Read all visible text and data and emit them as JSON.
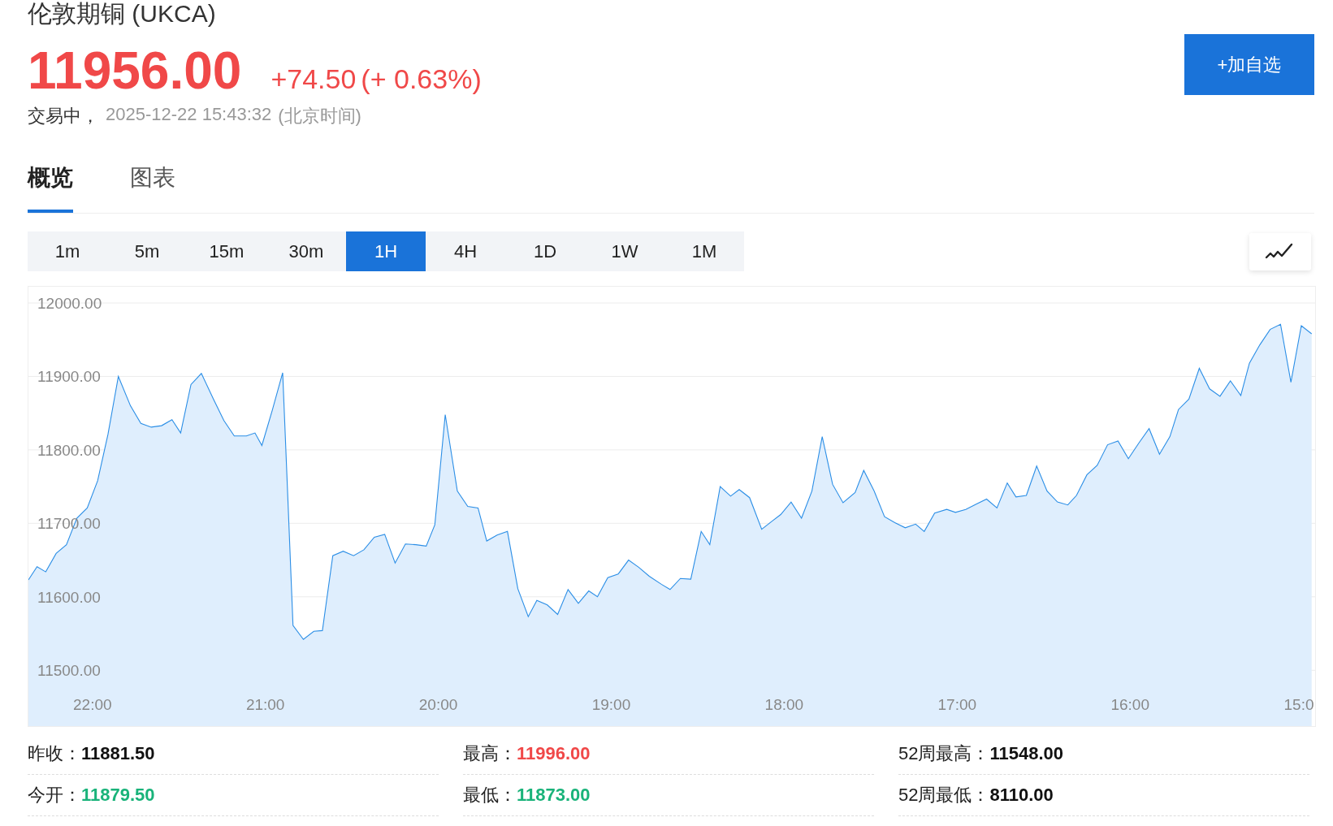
{
  "title": "伦敦期铜 (UKCA)",
  "price": "11956.00",
  "change": "+74.50",
  "change_pct": "(+ 0.63%)",
  "status": "交易中，",
  "timestamp": "2025-12-22 15:43:32",
  "timezone": "(北京时间)",
  "watch_button": "+加自选",
  "tabs": [
    {
      "label": "概览",
      "selected": true
    },
    {
      "label": "图表",
      "selected": false
    }
  ],
  "periods": [
    {
      "label": "1m",
      "selected": false
    },
    {
      "label": "5m",
      "selected": false
    },
    {
      "label": "15m",
      "selected": false
    },
    {
      "label": "30m",
      "selected": false
    },
    {
      "label": "1H",
      "selected": true
    },
    {
      "label": "4H",
      "selected": false
    },
    {
      "label": "1D",
      "selected": false
    },
    {
      "label": "1W",
      "selected": false
    },
    {
      "label": "1M",
      "selected": false
    }
  ],
  "chart_data": {
    "type": "area",
    "grid": true,
    "xlim": [
      22.37,
      14.93
    ],
    "ylim": [
      11424,
      12000
    ],
    "yticks": [
      {
        "value": 12000,
        "label": "12000.00"
      },
      {
        "value": 11900,
        "label": "11900.00"
      },
      {
        "value": 11800,
        "label": "11800.00"
      },
      {
        "value": 11700,
        "label": "11700.00"
      },
      {
        "value": 11600,
        "label": "11600.00"
      },
      {
        "value": 11500,
        "label": "11500.00"
      }
    ],
    "xticks": [
      {
        "value": 22,
        "label": "22:00"
      },
      {
        "value": 21,
        "label": "21:00"
      },
      {
        "value": 20,
        "label": "20:00"
      },
      {
        "value": 19,
        "label": "19:00"
      },
      {
        "value": 18,
        "label": "18:00"
      },
      {
        "value": 17,
        "label": "17:00"
      },
      {
        "value": 16,
        "label": "16:00"
      },
      {
        "value": 15,
        "label": "15:0"
      }
    ],
    "x": [
      22.37,
      22.32,
      22.27,
      22.21,
      22.15,
      22.09,
      22.03,
      21.97,
      21.91,
      21.85,
      21.78,
      21.72,
      21.66,
      21.6,
      21.54,
      21.49,
      21.43,
      21.37,
      21.3,
      21.24,
      21.18,
      21.11,
      21.06,
      21.02,
      20.96,
      20.9,
      20.87,
      20.84,
      20.78,
      20.72,
      20.67,
      20.61,
      20.55,
      20.49,
      20.43,
      20.37,
      20.31,
      20.25,
      20.19,
      20.13,
      20.07,
      20.02,
      19.96,
      19.89,
      19.83,
      19.77,
      19.72,
      19.66,
      19.6,
      19.54,
      19.48,
      19.43,
      19.37,
      19.31,
      19.25,
      19.19,
      19.13,
      19.08,
      19.02,
      18.96,
      18.9,
      18.84,
      18.78,
      18.71,
      18.66,
      18.6,
      18.54,
      18.48,
      18.43,
      18.37,
      18.31,
      18.26,
      18.2,
      18.13,
      18.07,
      18.02,
      17.96,
      17.9,
      17.84,
      17.78,
      17.72,
      17.66,
      17.59,
      17.54,
      17.48,
      17.42,
      17.36,
      17.3,
      17.24,
      17.19,
      17.13,
      17.06,
      17.01,
      16.95,
      16.89,
      16.83,
      16.77,
      16.71,
      16.66,
      16.6,
      16.54,
      16.48,
      16.42,
      16.36,
      16.31,
      16.25,
      16.19,
      16.13,
      16.07,
      16.01,
      15.95,
      15.89,
      15.83,
      15.77,
      15.72,
      15.66,
      15.6,
      15.54,
      15.48,
      15.42,
      15.36,
      15.31,
      15.25,
      15.19,
      15.13,
      15.07,
      15.01,
      14.95
    ],
    "series": [
      {
        "color": "#2b8ee6",
        "values": [
          11623,
          11641,
          11634,
          11659,
          11671,
          11707,
          11721,
          11758,
          11821,
          11900,
          11860,
          11836,
          11831,
          11833,
          11841,
          11823,
          11889,
          11904,
          11869,
          11840,
          11819,
          11819,
          11823,
          11806,
          11854,
          11905,
          11733,
          11561,
          11542,
          11553,
          11554,
          11656,
          11662,
          11656,
          11664,
          11681,
          11685,
          11646,
          11672,
          11671,
          11669,
          11698,
          11848,
          11744,
          11723,
          11721,
          11676,
          11684,
          11689,
          11611,
          11573,
          11595,
          11589,
          11576,
          11610,
          11591,
          11608,
          11600,
          11626,
          11631,
          11650,
          11640,
          11628,
          11617,
          11610,
          11625,
          11624,
          11689,
          11671,
          11750,
          11737,
          11746,
          11735,
          11692,
          11703,
          11712,
          11729,
          11707,
          11744,
          11818,
          11753,
          11728,
          11742,
          11772,
          11744,
          11709,
          11701,
          11694,
          11699,
          11689,
          11714,
          11719,
          11715,
          11719,
          11726,
          11733,
          11721,
          11755,
          11736,
          11738,
          11778,
          11744,
          11729,
          11725,
          11738,
          11766,
          11779,
          11807,
          11812,
          11788,
          11809,
          11829,
          11794,
          11818,
          11855,
          11869,
          11911,
          11883,
          11873,
          11894,
          11874,
          11918,
          11943,
          11964,
          11971,
          11892,
          11969,
          11958
        ]
      }
    ]
  },
  "stats": [
    {
      "label": "昨收：",
      "value": "11881.50",
      "color": "#111111"
    },
    {
      "label": "最高：",
      "value": "11996.00",
      "color": "#f04848"
    },
    {
      "label": "52周最高：",
      "value": "11548.00",
      "color": "#111111"
    },
    {
      "label": "今开：",
      "value": "11879.50",
      "color": "#19b37a"
    },
    {
      "label": "最低：",
      "value": "11873.00",
      "color": "#19b37a"
    },
    {
      "label": "52周最低：",
      "value": "8110.00",
      "color": "#111111"
    }
  ]
}
